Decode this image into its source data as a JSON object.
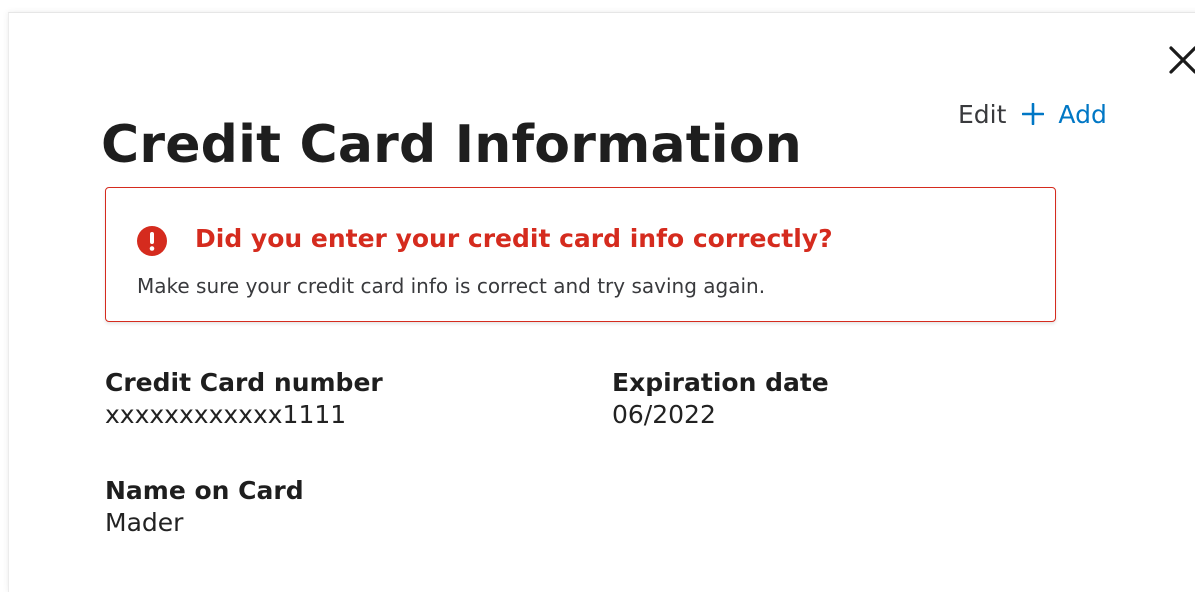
{
  "dialog": {
    "title": "Credit Card Information",
    "close_icon": "close-icon"
  },
  "actions": {
    "edit_label": "Edit",
    "add_label": "Add",
    "add_icon": "plus-icon"
  },
  "alert": {
    "icon": "alert-exclamation-icon",
    "title": "Did you enter your credit card info correctly?",
    "message": "Make sure your credit card info is correct and try saving again."
  },
  "fields": {
    "card_number": {
      "label": "Credit Card number",
      "value": "xxxxxxxxxxxx1111"
    },
    "expiration": {
      "label": "Expiration date",
      "value": "06/2022"
    },
    "name_on_card": {
      "label": "Name on Card",
      "value": "Mader"
    }
  },
  "colors": {
    "error": "#d52b1e",
    "link": "#0077c5",
    "text": "#1e1e1e"
  }
}
